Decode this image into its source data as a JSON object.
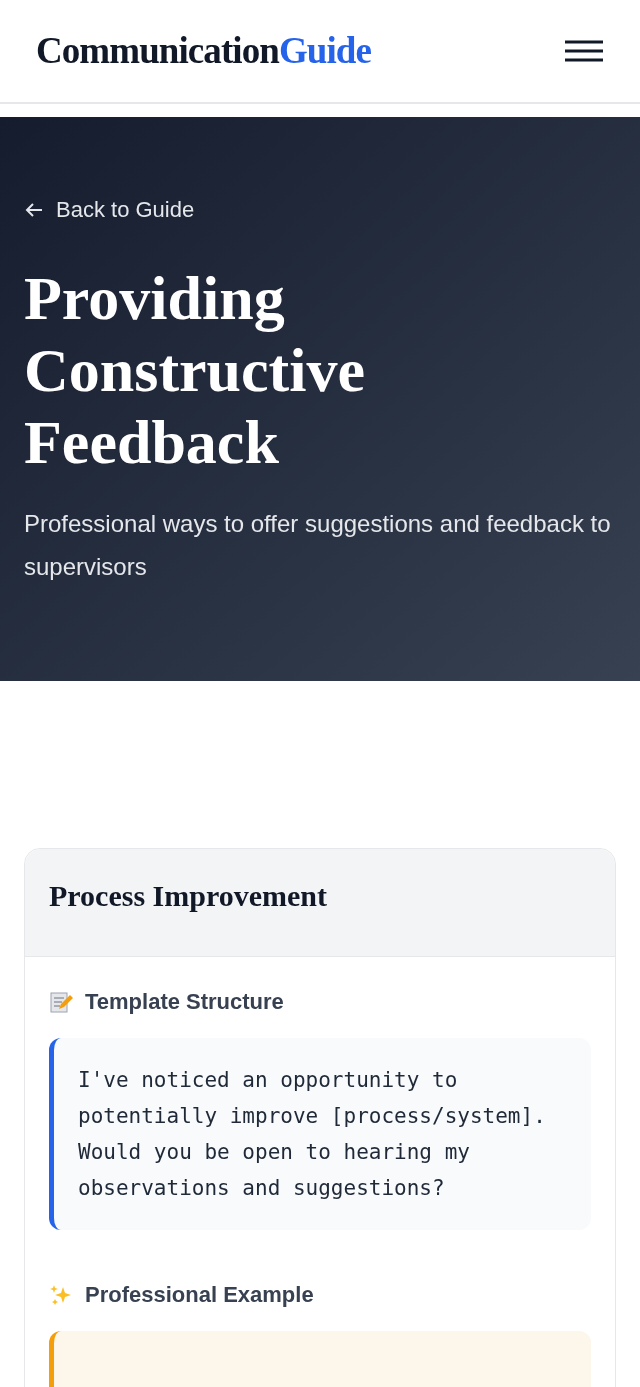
{
  "header": {
    "logo_primary": "Communication",
    "logo_accent": "Guide"
  },
  "hero": {
    "back_link": "Back to Guide",
    "title": "Providing Constructive Feedback",
    "subtitle": "Professional ways to offer suggestions and feedback to supervisors"
  },
  "card": {
    "title": "Process Improvement",
    "sections": [
      {
        "kind": "template",
        "heading": "Template Structure",
        "text": "I've noticed an opportunity to potentially improve [process/system]. Would you be open to hearing my observations and suggestions?"
      },
      {
        "kind": "example",
        "heading": "Professional Example"
      }
    ]
  }
}
